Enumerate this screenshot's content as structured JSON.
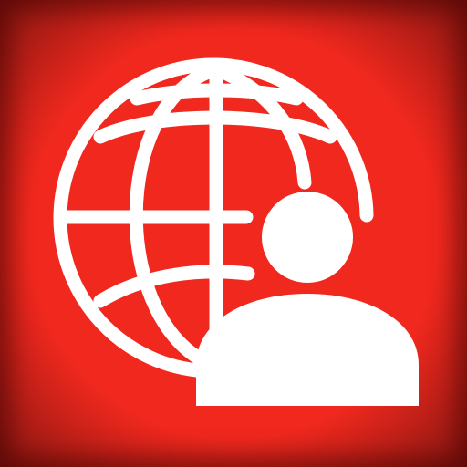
{
  "icon": {
    "name": "globe-user-app-icon",
    "glyphs": [
      "globe-icon",
      "user-icon"
    ],
    "colors": {
      "background": "#F0281E",
      "glyph": "#FFFFFF"
    }
  }
}
